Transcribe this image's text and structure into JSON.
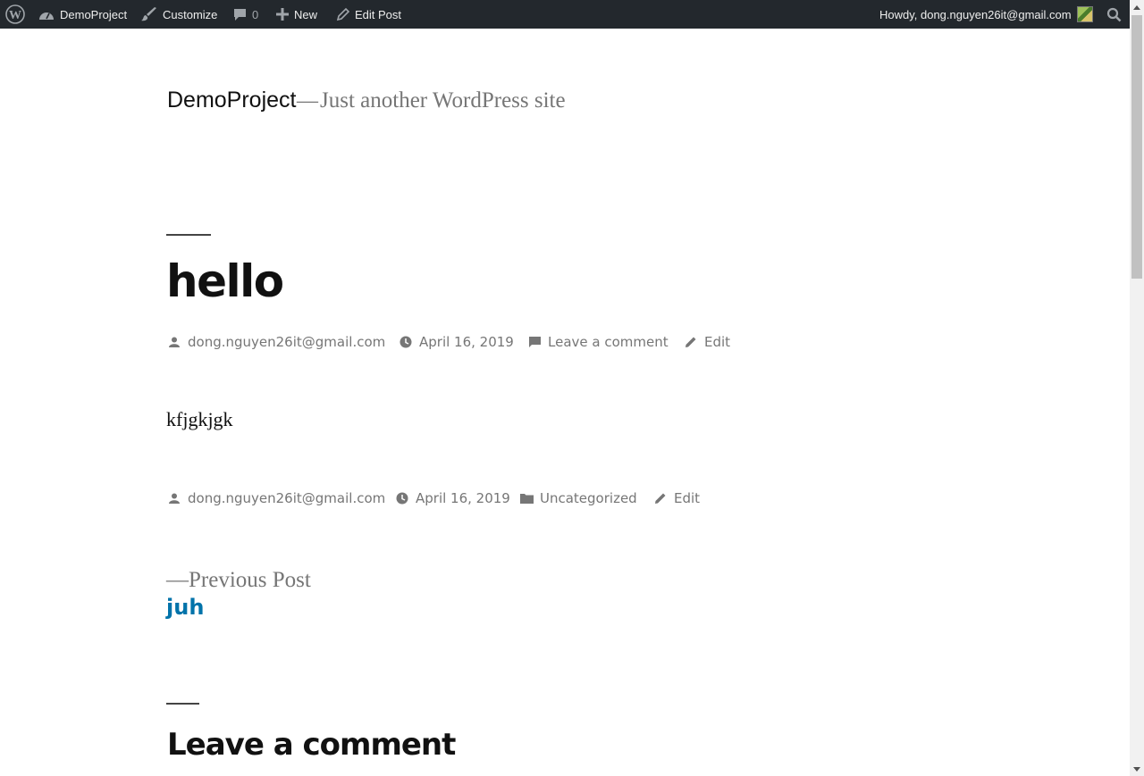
{
  "admin_bar": {
    "site_name": "DemoProject",
    "customize": "Customize",
    "comments_count": "0",
    "new": "New",
    "edit_post": "Edit Post",
    "greeting": "Howdy, dong.nguyen26it@gmail.com"
  },
  "site": {
    "title": "DemoProject",
    "separator": "—",
    "description": "Just another WordPress site"
  },
  "post": {
    "title": "hello",
    "author": "dong.nguyen26it@gmail.com",
    "date": "April 16, 2019",
    "comment_link": "Leave a comment",
    "edit": "Edit",
    "content": "kfjgkjgk",
    "category": "Uncategorized"
  },
  "navigation": {
    "previous_label": "—Previous Post",
    "previous_title": "juh"
  },
  "comments": {
    "title": "Leave a comment"
  },
  "colors": {
    "admin_bar_bg": "#23282d",
    "link": "#0073aa",
    "meta_text": "#767676"
  }
}
